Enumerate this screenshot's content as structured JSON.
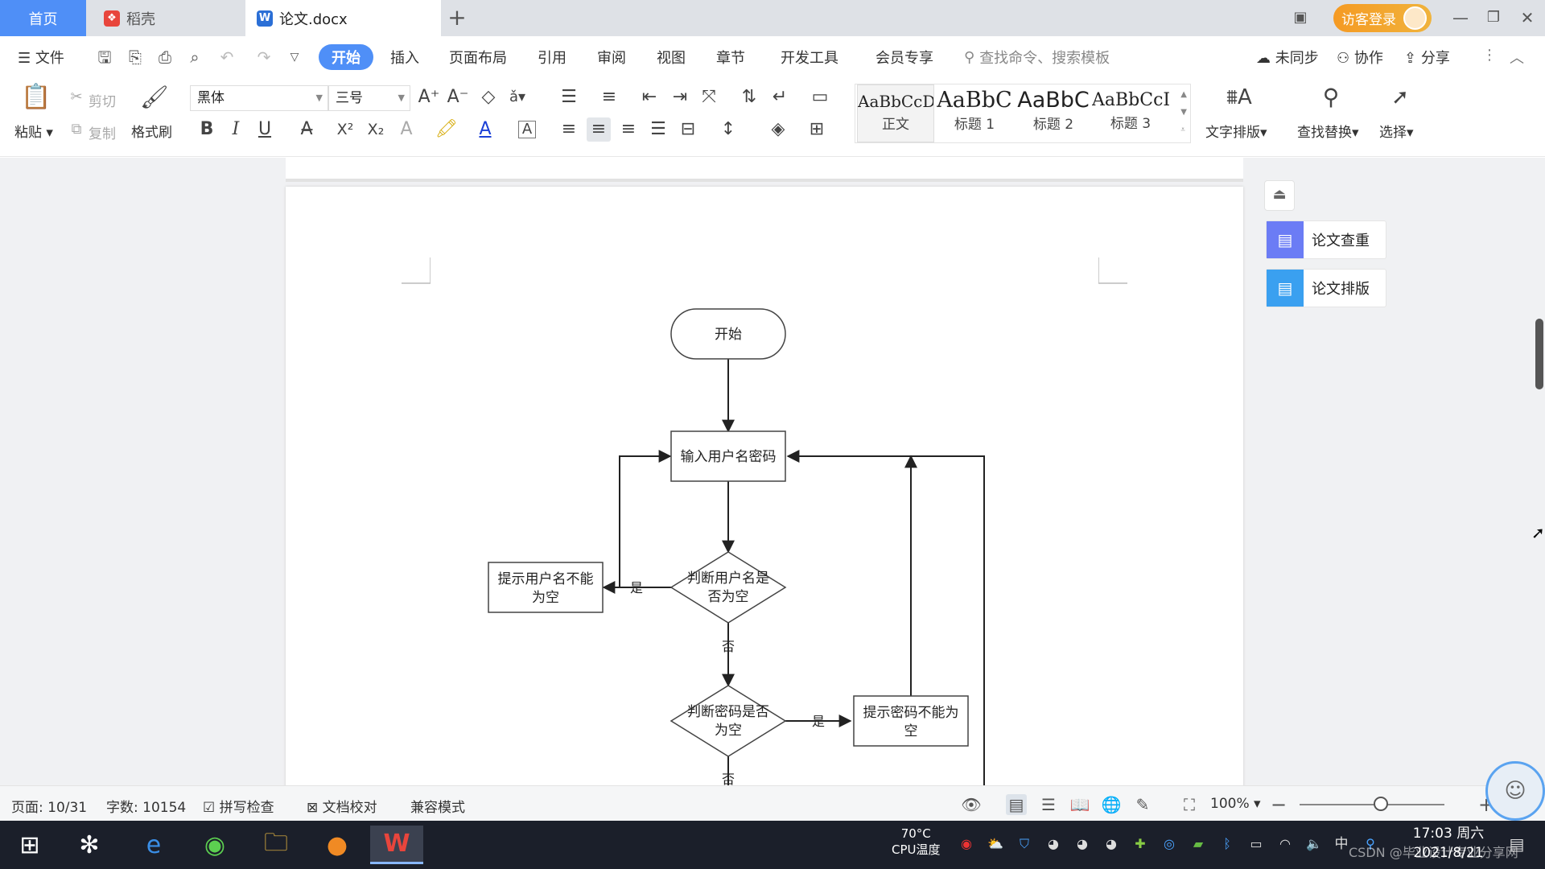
{
  "tabs": {
    "home": "首页",
    "daoke": "稻壳",
    "doc": "论文.docx"
  },
  "titlebar": {
    "login": "访客登录"
  },
  "menu": {
    "file": "文件",
    "items": [
      "开始",
      "插入",
      "页面布局",
      "引用",
      "审阅",
      "视图",
      "章节",
      "开发工具",
      "会员专享"
    ],
    "search_placeholder": "查找命令、搜索模板",
    "sync": "未同步",
    "collab": "协作",
    "share": "分享"
  },
  "ribbon": {
    "paste": "粘贴",
    "cut": "剪切",
    "copy": "复制",
    "format_painter": "格式刷",
    "font_name": "黑体",
    "font_size": "三号",
    "styles": [
      {
        "preview": "AaBbCcDd",
        "label": "正文"
      },
      {
        "preview": "AaBbC",
        "label": "标题 1"
      },
      {
        "preview": "AaBbC",
        "label": "标题 2"
      },
      {
        "preview": "AaBbCcI",
        "label": "标题 3"
      }
    ],
    "text_layout": "文字排版",
    "find_replace": "查找替换",
    "select": "选择"
  },
  "flowchart": {
    "start": "开始",
    "input": "输入用户名密码",
    "check_user": [
      "判断用户名是",
      "否为空"
    ],
    "prompt_user": [
      "提示用户名不能",
      "为空"
    ],
    "check_pwd": [
      "判断密码是否",
      "为空"
    ],
    "prompt_pwd": [
      "提示密码不能为",
      "空"
    ],
    "yes": "是",
    "no": "否"
  },
  "side_panel": {
    "check": "论文查重",
    "layout": "论文排版"
  },
  "status": {
    "page": "页面: 10/31",
    "words": "字数: 10154",
    "spell": "拼写检查",
    "proof": "文档校对",
    "compat": "兼容模式",
    "zoom": "100%",
    "zoom_level": 1.0
  },
  "taskbar": {
    "cpu_temp": "70°C",
    "cpu_label": "CPU温度",
    "ime": "中",
    "time": "17:03 周六",
    "date": "2021/8/21",
    "watermark": "CSDN @毕业设计专业分享网"
  },
  "colors": {
    "accent": "#4f8ff7",
    "login": "#f5a023",
    "taskbar": "#1b1f2a"
  }
}
